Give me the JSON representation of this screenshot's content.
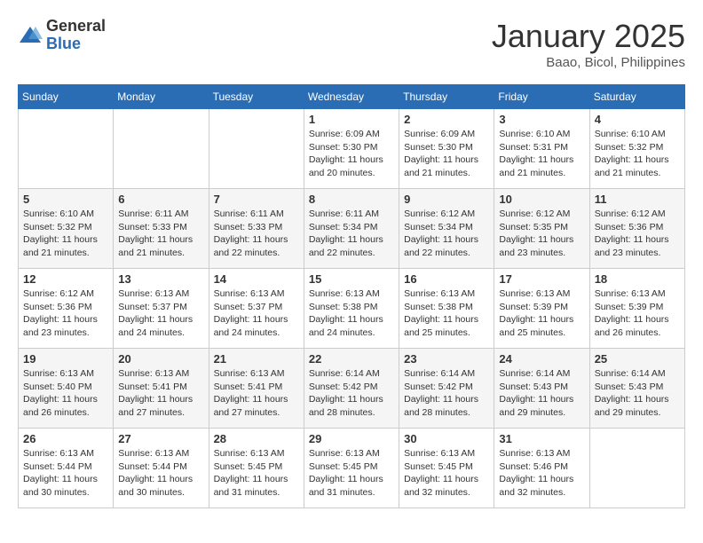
{
  "logo": {
    "general": "General",
    "blue": "Blue"
  },
  "title": "January 2025",
  "location": "Baao, Bicol, Philippines",
  "days": [
    "Sunday",
    "Monday",
    "Tuesday",
    "Wednesday",
    "Thursday",
    "Friday",
    "Saturday"
  ],
  "weeks": [
    [
      {
        "day": "",
        "content": ""
      },
      {
        "day": "",
        "content": ""
      },
      {
        "day": "",
        "content": ""
      },
      {
        "day": "1",
        "content": "Sunrise: 6:09 AM\nSunset: 5:30 PM\nDaylight: 11 hours\nand 20 minutes."
      },
      {
        "day": "2",
        "content": "Sunrise: 6:09 AM\nSunset: 5:30 PM\nDaylight: 11 hours\nand 21 minutes."
      },
      {
        "day": "3",
        "content": "Sunrise: 6:10 AM\nSunset: 5:31 PM\nDaylight: 11 hours\nand 21 minutes."
      },
      {
        "day": "4",
        "content": "Sunrise: 6:10 AM\nSunset: 5:32 PM\nDaylight: 11 hours\nand 21 minutes."
      }
    ],
    [
      {
        "day": "5",
        "content": "Sunrise: 6:10 AM\nSunset: 5:32 PM\nDaylight: 11 hours\nand 21 minutes."
      },
      {
        "day": "6",
        "content": "Sunrise: 6:11 AM\nSunset: 5:33 PM\nDaylight: 11 hours\nand 21 minutes."
      },
      {
        "day": "7",
        "content": "Sunrise: 6:11 AM\nSunset: 5:33 PM\nDaylight: 11 hours\nand 22 minutes."
      },
      {
        "day": "8",
        "content": "Sunrise: 6:11 AM\nSunset: 5:34 PM\nDaylight: 11 hours\nand 22 minutes."
      },
      {
        "day": "9",
        "content": "Sunrise: 6:12 AM\nSunset: 5:34 PM\nDaylight: 11 hours\nand 22 minutes."
      },
      {
        "day": "10",
        "content": "Sunrise: 6:12 AM\nSunset: 5:35 PM\nDaylight: 11 hours\nand 23 minutes."
      },
      {
        "day": "11",
        "content": "Sunrise: 6:12 AM\nSunset: 5:36 PM\nDaylight: 11 hours\nand 23 minutes."
      }
    ],
    [
      {
        "day": "12",
        "content": "Sunrise: 6:12 AM\nSunset: 5:36 PM\nDaylight: 11 hours\nand 23 minutes."
      },
      {
        "day": "13",
        "content": "Sunrise: 6:13 AM\nSunset: 5:37 PM\nDaylight: 11 hours\nand 24 minutes."
      },
      {
        "day": "14",
        "content": "Sunrise: 6:13 AM\nSunset: 5:37 PM\nDaylight: 11 hours\nand 24 minutes."
      },
      {
        "day": "15",
        "content": "Sunrise: 6:13 AM\nSunset: 5:38 PM\nDaylight: 11 hours\nand 24 minutes."
      },
      {
        "day": "16",
        "content": "Sunrise: 6:13 AM\nSunset: 5:38 PM\nDaylight: 11 hours\nand 25 minutes."
      },
      {
        "day": "17",
        "content": "Sunrise: 6:13 AM\nSunset: 5:39 PM\nDaylight: 11 hours\nand 25 minutes."
      },
      {
        "day": "18",
        "content": "Sunrise: 6:13 AM\nSunset: 5:39 PM\nDaylight: 11 hours\nand 26 minutes."
      }
    ],
    [
      {
        "day": "19",
        "content": "Sunrise: 6:13 AM\nSunset: 5:40 PM\nDaylight: 11 hours\nand 26 minutes."
      },
      {
        "day": "20",
        "content": "Sunrise: 6:13 AM\nSunset: 5:41 PM\nDaylight: 11 hours\nand 27 minutes."
      },
      {
        "day": "21",
        "content": "Sunrise: 6:13 AM\nSunset: 5:41 PM\nDaylight: 11 hours\nand 27 minutes."
      },
      {
        "day": "22",
        "content": "Sunrise: 6:14 AM\nSunset: 5:42 PM\nDaylight: 11 hours\nand 28 minutes."
      },
      {
        "day": "23",
        "content": "Sunrise: 6:14 AM\nSunset: 5:42 PM\nDaylight: 11 hours\nand 28 minutes."
      },
      {
        "day": "24",
        "content": "Sunrise: 6:14 AM\nSunset: 5:43 PM\nDaylight: 11 hours\nand 29 minutes."
      },
      {
        "day": "25",
        "content": "Sunrise: 6:14 AM\nSunset: 5:43 PM\nDaylight: 11 hours\nand 29 minutes."
      }
    ],
    [
      {
        "day": "26",
        "content": "Sunrise: 6:13 AM\nSunset: 5:44 PM\nDaylight: 11 hours\nand 30 minutes."
      },
      {
        "day": "27",
        "content": "Sunrise: 6:13 AM\nSunset: 5:44 PM\nDaylight: 11 hours\nand 30 minutes."
      },
      {
        "day": "28",
        "content": "Sunrise: 6:13 AM\nSunset: 5:45 PM\nDaylight: 11 hours\nand 31 minutes."
      },
      {
        "day": "29",
        "content": "Sunrise: 6:13 AM\nSunset: 5:45 PM\nDaylight: 11 hours\nand 31 minutes."
      },
      {
        "day": "30",
        "content": "Sunrise: 6:13 AM\nSunset: 5:45 PM\nDaylight: 11 hours\nand 32 minutes."
      },
      {
        "day": "31",
        "content": "Sunrise: 6:13 AM\nSunset: 5:46 PM\nDaylight: 11 hours\nand 32 minutes."
      },
      {
        "day": "",
        "content": ""
      }
    ]
  ]
}
